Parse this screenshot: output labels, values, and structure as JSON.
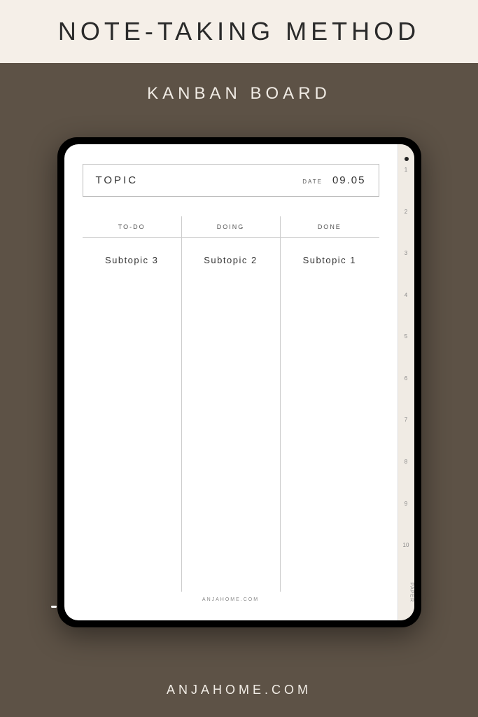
{
  "header": {
    "title": "NOTE-TAKING METHOD",
    "subtitle": "KANBAN BOARD"
  },
  "page": {
    "topic_label": "TOPIC",
    "date_label": "DATE",
    "date_value": "09.05",
    "footer": "ANJAHOME.COM"
  },
  "columns": [
    {
      "header": "TO-DO",
      "content": "Subtopic 3"
    },
    {
      "header": "DOING",
      "content": "Subtopic 2"
    },
    {
      "header": "DONE",
      "content": "Subtopic 1"
    }
  ],
  "tabs": [
    "1",
    "2",
    "3",
    "4",
    "5",
    "6",
    "7",
    "8",
    "9",
    "10",
    "PAPER"
  ],
  "brand": "ANJAHOME.COM"
}
